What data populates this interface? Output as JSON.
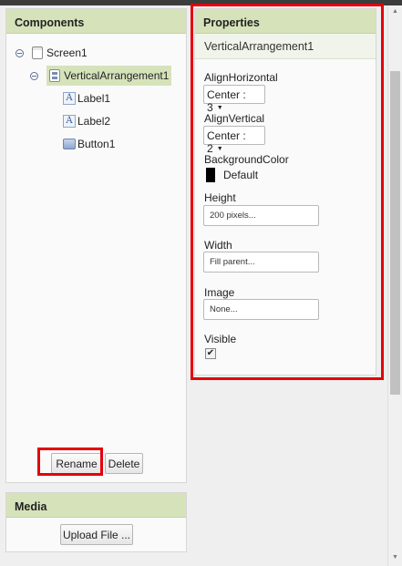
{
  "components": {
    "header": "Components",
    "tree": {
      "screen": "Screen1",
      "arrangement": "VerticalArrangement1",
      "children": [
        "Label1",
        "Label2",
        "Button1"
      ]
    },
    "rename_label": "Rename",
    "delete_label": "Delete"
  },
  "media": {
    "header": "Media",
    "upload_label": "Upload File ..."
  },
  "properties": {
    "header": "Properties",
    "component_name": "VerticalArrangement1",
    "align_horizontal": {
      "label": "AlignHorizontal",
      "value": "Center : 3"
    },
    "align_vertical": {
      "label": "AlignVertical",
      "value": "Center : 2"
    },
    "background_color": {
      "label": "BackgroundColor",
      "value": "Default",
      "swatch": "#000000"
    },
    "height": {
      "label": "Height",
      "value": "200 pixels..."
    },
    "width": {
      "label": "Width",
      "value": "Fill parent..."
    },
    "image": {
      "label": "Image",
      "value": "None..."
    },
    "visible": {
      "label": "Visible",
      "checked": true
    }
  },
  "highlight_color": "#e4000b",
  "header_color": "#d6e3ba",
  "icons": {
    "collapse": "minus-circle-icon",
    "screen": "screen-icon",
    "arrangement": "vertical-arrangement-icon",
    "label": "label-icon",
    "button": "button-icon",
    "dropdown": "caret-down-icon",
    "checkbox": "check-icon"
  }
}
